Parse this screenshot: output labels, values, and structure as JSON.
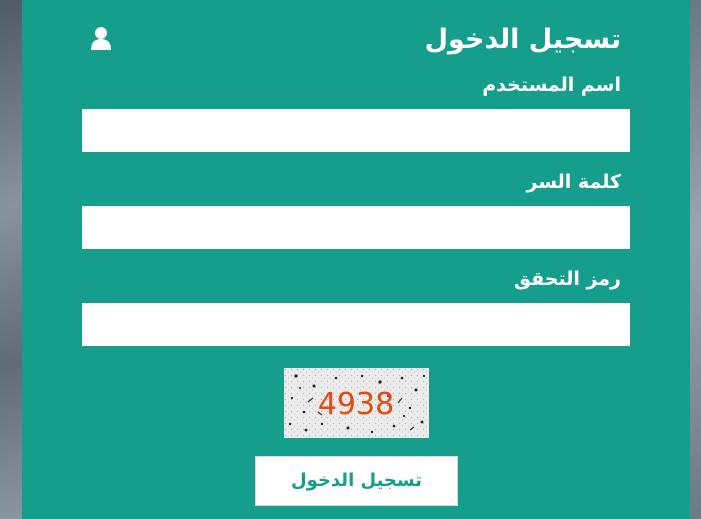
{
  "login_form": {
    "title": "تسجيل الدخول",
    "title_icon": "user-icon",
    "username_label": "اسم المستخدم",
    "username_value": "",
    "password_label": "كلمة السر",
    "password_value": "",
    "captcha_label": "رمز التحقق",
    "captcha_value": "",
    "captcha_code": "4938",
    "submit_label": "تسجيل الدخول"
  },
  "colors": {
    "panel_background": "#169e8c",
    "text_on_panel": "#ffffff",
    "button_text": "#169e8c",
    "captcha_text": "#e24b12"
  }
}
